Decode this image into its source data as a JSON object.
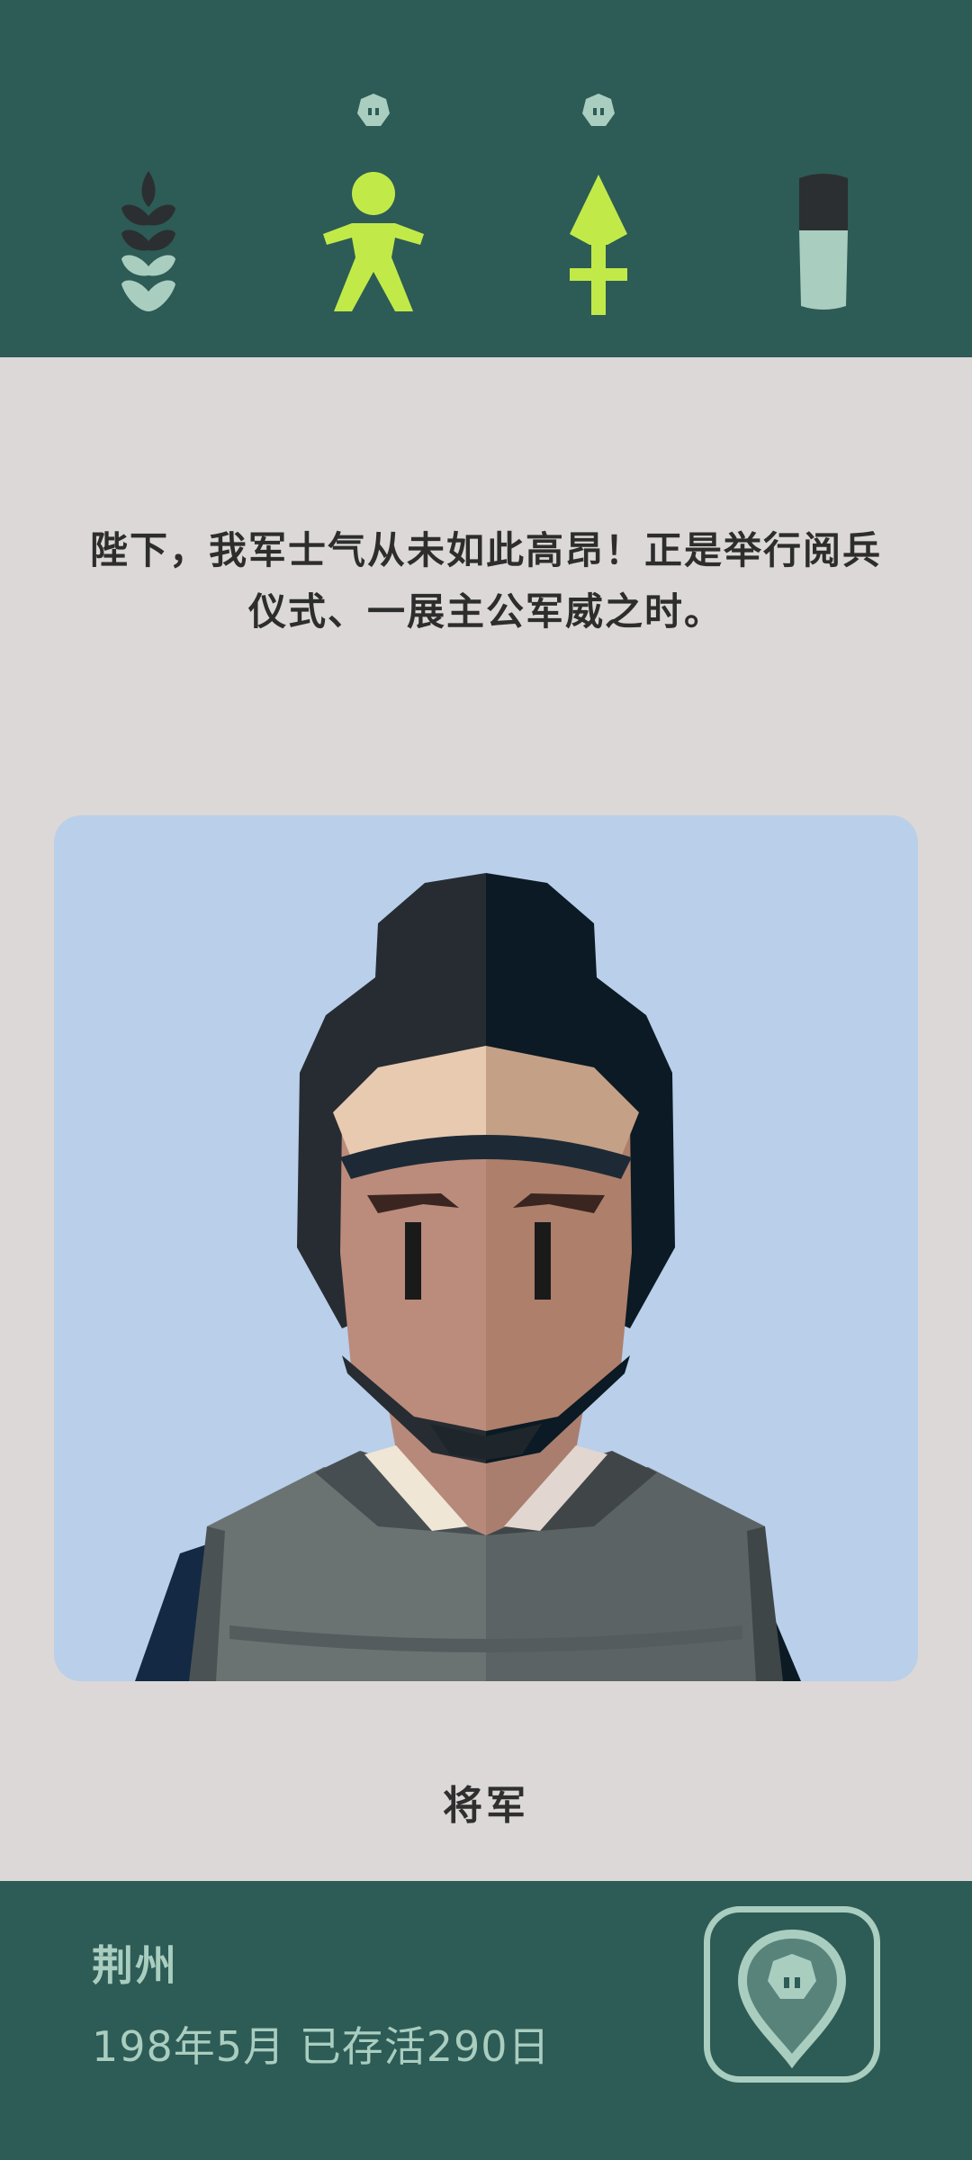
{
  "stats": [
    {
      "name": "grain",
      "icon": "wheat-icon",
      "changed": false
    },
    {
      "name": "people",
      "icon": "person-icon",
      "changed": true
    },
    {
      "name": "military",
      "icon": "sword-icon",
      "changed": true
    },
    {
      "name": "treasury",
      "icon": "coin-stack-icon",
      "changed": false
    }
  ],
  "card": {
    "message_line1": "陛下，我军士气从未如此高昂！正是举行阅兵",
    "message_line2": "仪式、一展主公军威之时。",
    "character_name": "将军",
    "character_portrait": "general-portrait"
  },
  "status": {
    "location": "荆州",
    "date": "198年5月 已存活290日"
  },
  "map_button_icon": "map-pin-icon",
  "colors": {
    "bar_bg": "#2d5b56",
    "page_bg": "#dcd8d7",
    "card_bg": "#b9cfea",
    "accent": "#c1ea49",
    "muted_text": "#a9cdbf"
  }
}
